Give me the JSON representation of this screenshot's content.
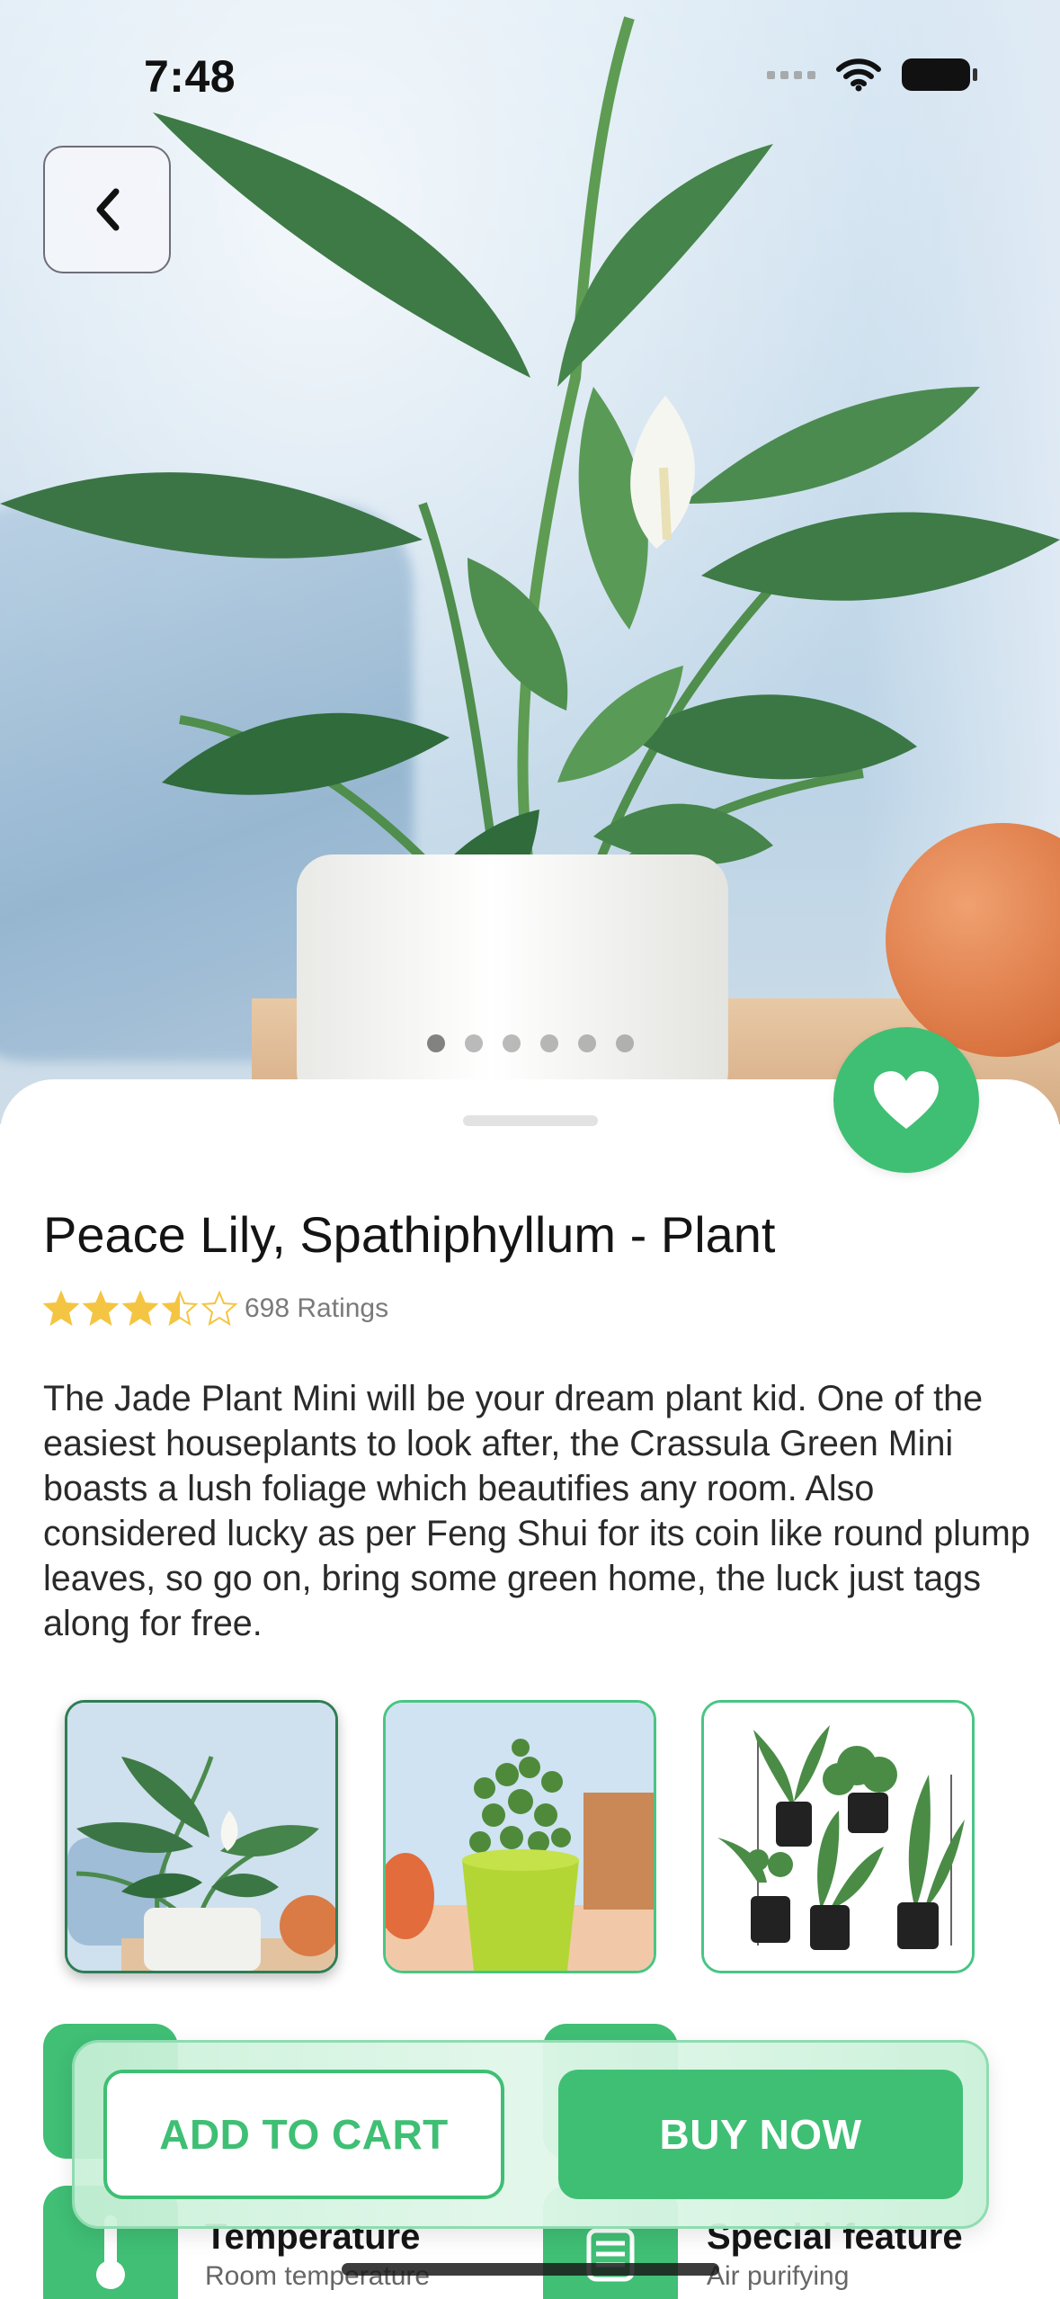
{
  "status_bar": {
    "time": "7:48"
  },
  "product": {
    "title": "Peace Lily, Spathiphyllum - Plant",
    "rating_value": 3.5,
    "rating_max": 5,
    "ratings_text": "698 Ratings",
    "description": "The Jade Plant Mini will be your dream plant kid. One of the easiest houseplants to look after, the Crassula Green Mini boasts a lush foliage which beautifies any room. Also considered lucky as per Feng Shui for its coin like round plump leaves, so go on, bring some green home, the luck just tags along for free."
  },
  "carousel": {
    "total": 6,
    "active_index": 0
  },
  "gallery": {
    "selected_index": 0,
    "items": [
      "peace-lily-thumbnail",
      "jade-plant-thumbnail",
      "plant-set-thumbnail"
    ]
  },
  "features": [
    {
      "title": "Temperature",
      "subtitle": "Room temperature",
      "icon": "thermometer-icon"
    },
    {
      "title": "Special feature",
      "subtitle": "Air purifying",
      "icon": "air-purifier-icon"
    }
  ],
  "actions": {
    "add_to_cart": "ADD TO CART",
    "buy_now": "BUY NOW"
  },
  "colors": {
    "accent": "#3fbf74",
    "accent_dark": "#2e7d55",
    "star": "#f4c542"
  }
}
